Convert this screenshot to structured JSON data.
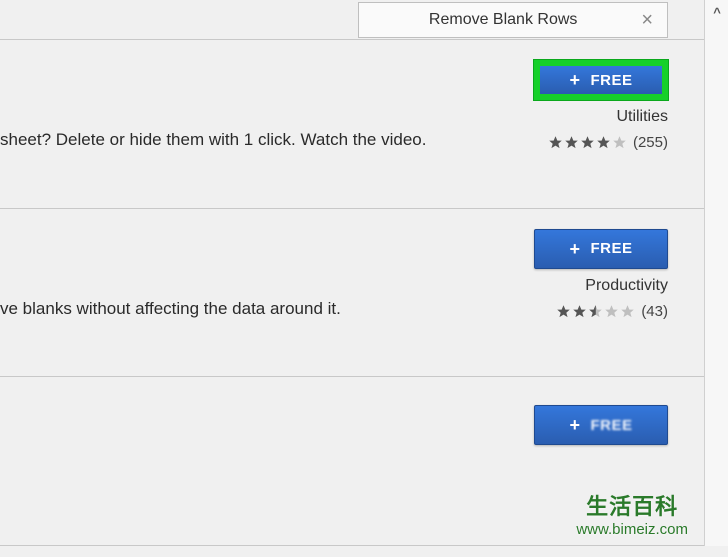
{
  "search": {
    "value": "Remove Blank Rows"
  },
  "items": [
    {
      "description": "sheet? Delete or hide them with 1 click. Watch the video.",
      "button_label": "FREE",
      "category": "Utilities",
      "rating": 4,
      "rating_count": "(255)",
      "highlighted": true
    },
    {
      "description": "ve blanks without affecting the data around it.",
      "button_label": "FREE",
      "category": "Productivity",
      "rating": 2.5,
      "rating_count": "(43)",
      "highlighted": false
    },
    {
      "description": "",
      "button_label": "FREE",
      "category": "",
      "rating": null,
      "rating_count": "",
      "highlighted": false
    }
  ],
  "watermark": {
    "title": "生活百科",
    "url": "www.bimeiz.com"
  }
}
